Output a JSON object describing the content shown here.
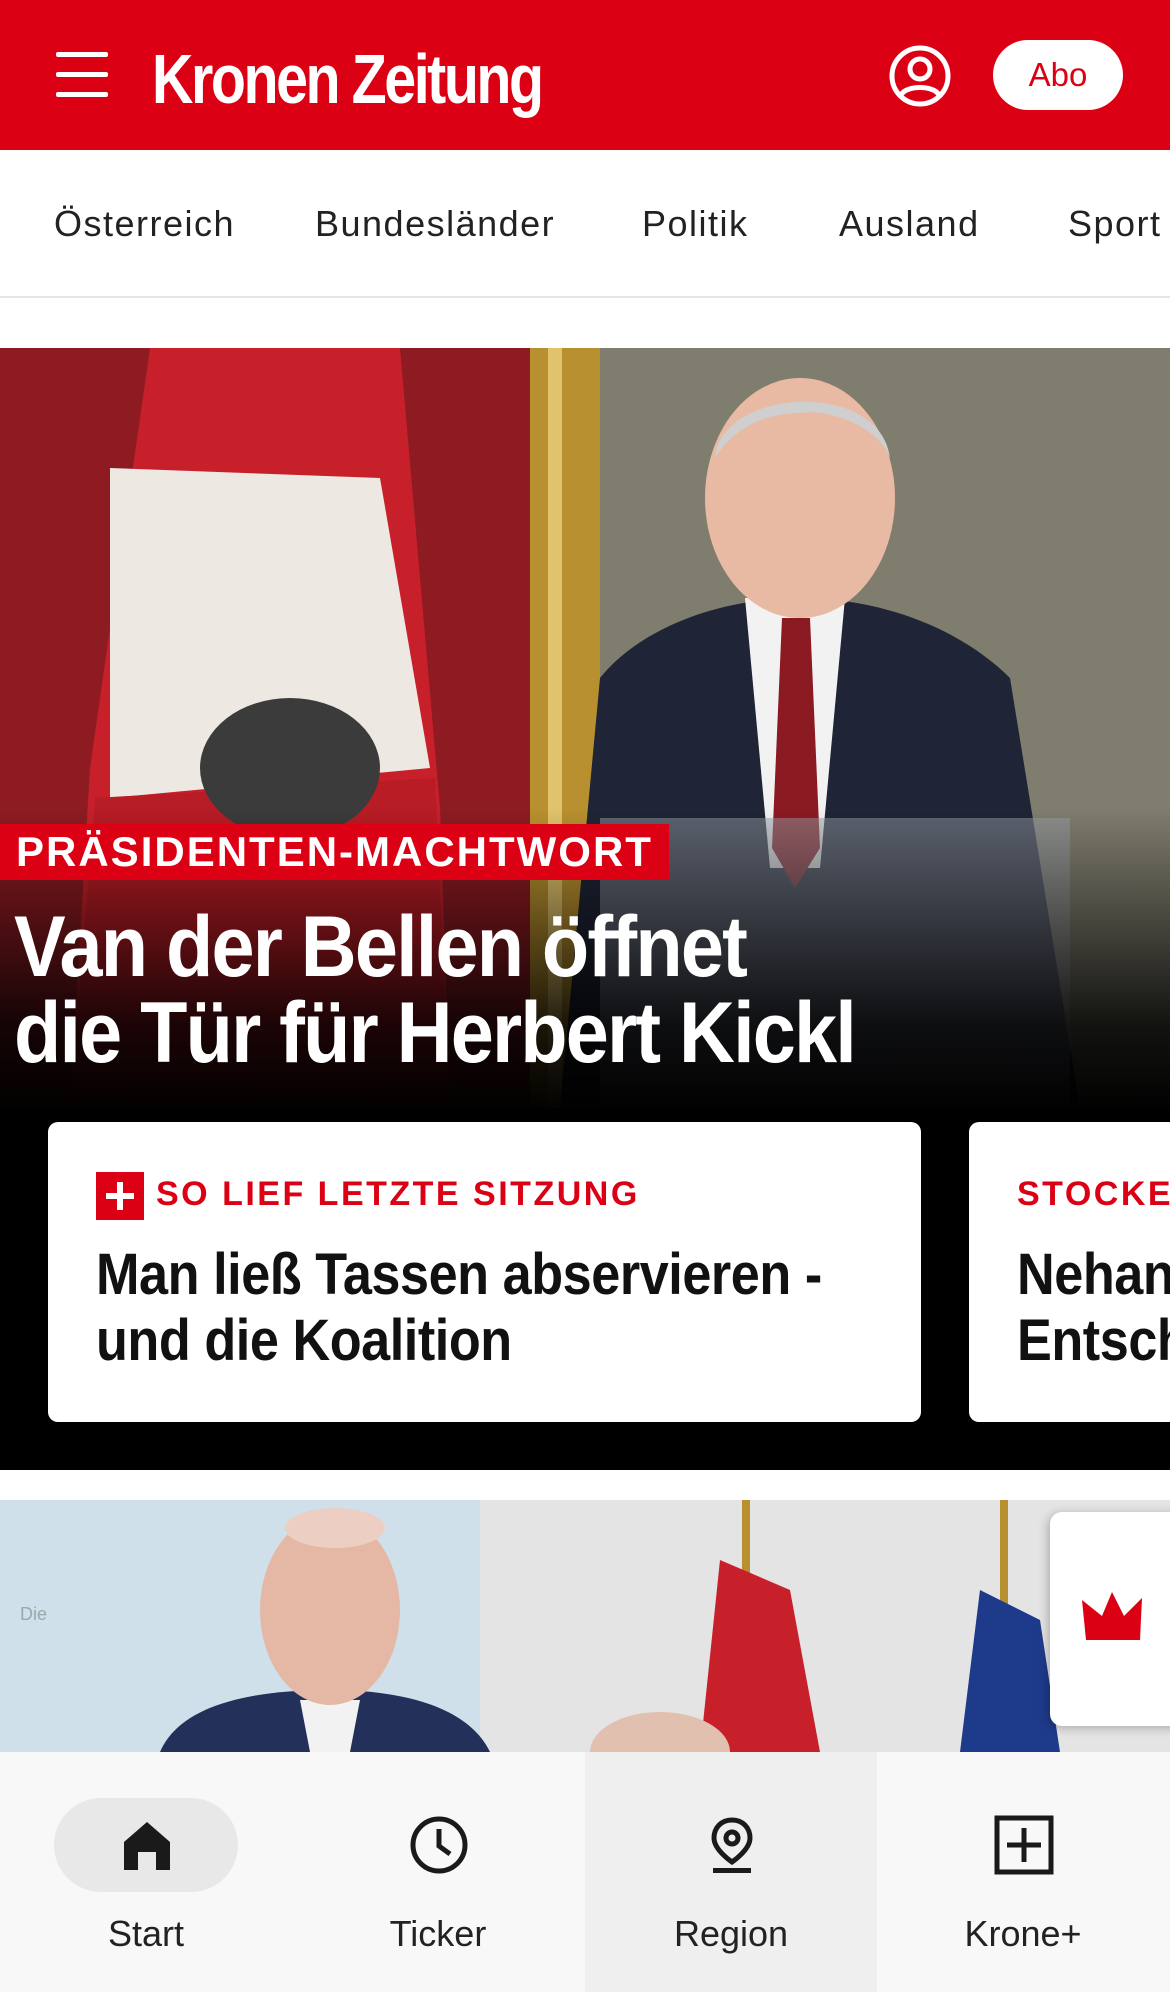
{
  "header": {
    "logo_text": "Kronen Zeitung",
    "abo_label": "Abo",
    "brand_color": "#dc0014"
  },
  "categories": [
    "Österreich",
    "Bundesländer",
    "Politik",
    "Ausland",
    "Sport"
  ],
  "hero": {
    "kicker": "PRÄSIDENTEN-MACHTWORT",
    "headline_line1": "Van der Bellen öffnet",
    "headline_line2": "die Tür für Herbert Kickl"
  },
  "cards": [
    {
      "kicker": "SO LIEF LETZTE SITZUNG",
      "title": "Man ließ Tassen abservieren - und die Koalition",
      "premium": true
    },
    {
      "kicker": "STOCKER",
      "title_line1": "Nehan",
      "title_line2": "Entsch",
      "premium": false
    }
  ],
  "bottom_nav": [
    {
      "label": "Start",
      "icon": "home-icon"
    },
    {
      "label": "Ticker",
      "icon": "clock-icon"
    },
    {
      "label": "Region",
      "icon": "location-pin-icon"
    },
    {
      "label": "Krone+",
      "icon": "plus-square-icon"
    }
  ]
}
